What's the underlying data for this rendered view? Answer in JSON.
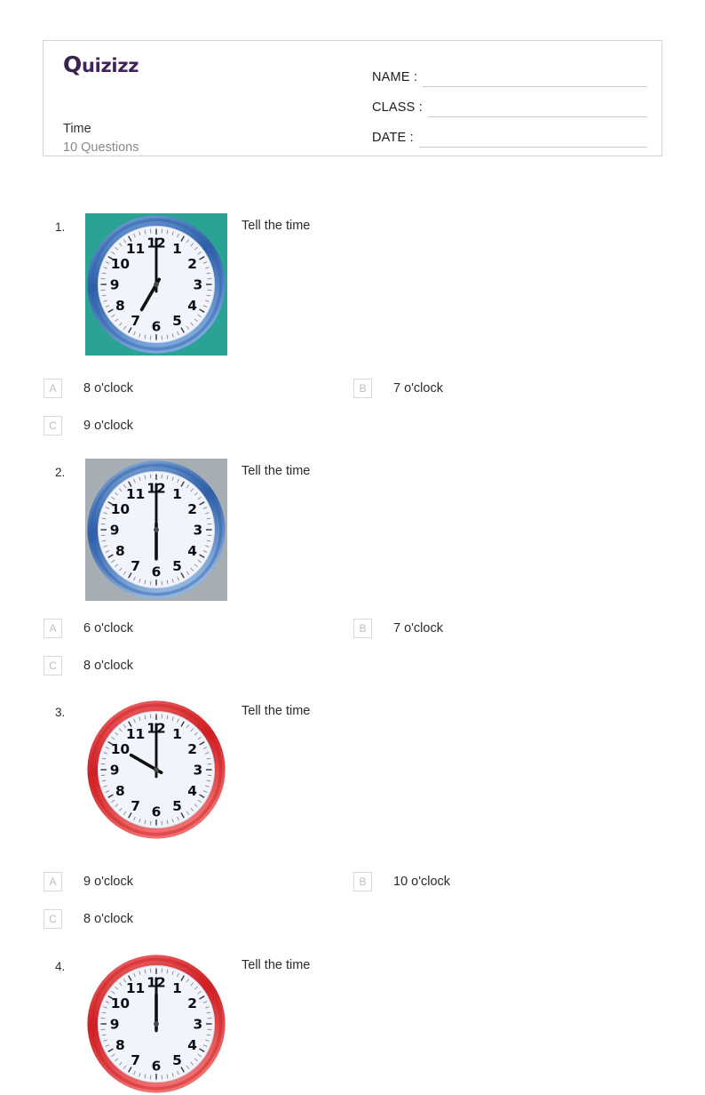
{
  "header": {
    "logo_text": "Quizizz",
    "quiz_title": "Time",
    "question_count_label": "10 Questions",
    "fields": [
      {
        "label": "NAME :",
        "value": ""
      },
      {
        "label": "CLASS :",
        "value": ""
      },
      {
        "label": "DATE  :",
        "value": ""
      }
    ]
  },
  "questions": [
    {
      "number": "1.",
      "prompt": "Tell the time",
      "image": {
        "name": "analog-clock-image",
        "background": "#2aa395",
        "rim_color": "#2f5fa8",
        "rim_color_light": "#7aa6dd",
        "hour": 7,
        "minute": 0,
        "time_label": "7 o'clock"
      },
      "options": [
        {
          "letter": "A",
          "text": "8 o'clock"
        },
        {
          "letter": "B",
          "text": "7 o'clock"
        },
        {
          "letter": "C",
          "text": "9 o'clock"
        }
      ]
    },
    {
      "number": "2.",
      "prompt": "Tell the time",
      "image": {
        "name": "analog-clock-image",
        "background": "#a6adb3",
        "rim_color": "#2f5fa8",
        "rim_color_light": "#8fb4e0",
        "hour": 6,
        "minute": 0,
        "time_label": "6 o'clock"
      },
      "options": [
        {
          "letter": "A",
          "text": "6 o'clock"
        },
        {
          "letter": "B",
          "text": "7 o'clock"
        },
        {
          "letter": "C",
          "text": "8 o'clock"
        }
      ]
    },
    {
      "number": "3.",
      "prompt": "Tell the time",
      "image": {
        "name": "analog-clock-image",
        "background": "#ffffff",
        "rim_color": "#cf1f24",
        "rim_color_light": "#ef6f6f",
        "hour": 10,
        "minute": 0,
        "time_label": "10 o'clock"
      },
      "options": [
        {
          "letter": "A",
          "text": "9 o'clock"
        },
        {
          "letter": "B",
          "text": "10 o'clock"
        },
        {
          "letter": "C",
          "text": "8 o'clock"
        }
      ]
    },
    {
      "number": "4.",
      "prompt": "Tell the time",
      "image": {
        "name": "analog-clock-image",
        "background": "#ffffff",
        "rim_color": "#cf1f24",
        "rim_color_light": "#ef6f6f",
        "hour": 12,
        "minute": 0,
        "time_label": ""
      },
      "options": []
    }
  ],
  "clock_face": {
    "numerals": [
      "12",
      "1",
      "2",
      "3",
      "4",
      "5",
      "6",
      "7",
      "8",
      "9",
      "10",
      "11"
    ],
    "face_color": "#f2f4fb",
    "hand_color": "#101010"
  },
  "layout": {
    "question_tops": [
      240,
      516,
      786,
      1072
    ],
    "option_tops": [
      426,
      696,
      981,
      0
    ]
  }
}
